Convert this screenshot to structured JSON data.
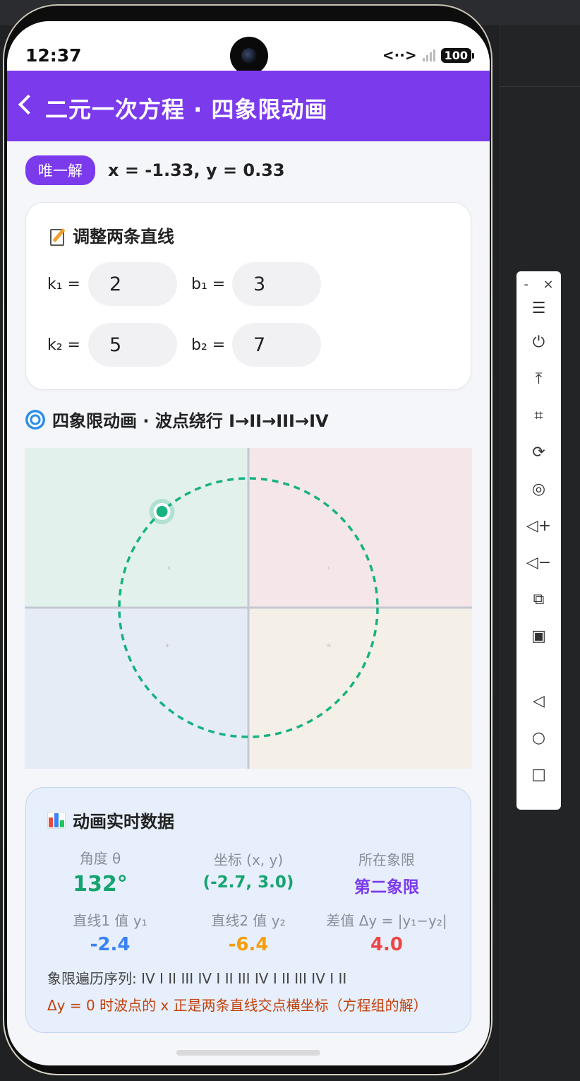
{
  "status": {
    "time": "12:37",
    "battery": "100",
    "network": "<··>"
  },
  "header": {
    "title": "二元一次方程 · 四象限动画"
  },
  "solution": {
    "badge": "唯一解",
    "text": "x = -1.33,  y = 0.33"
  },
  "inputs": {
    "title": "调整两条直线",
    "k1_label": "k₁ =",
    "k1_value": "2",
    "b1_label": "b₁ =",
    "b1_value": "3",
    "k2_label": "k₂ =",
    "k2_value": "5",
    "b2_label": "b₂ =",
    "b2_value": "7"
  },
  "animation": {
    "title": "四象限动画 · 波点绕行 I→II→III→IV",
    "quadrant_labels": [
      "II",
      "I",
      "III",
      "IV"
    ],
    "angle_deg": 132,
    "colors": {
      "q1": "#f5e6ea",
      "q2": "#e3f1ec",
      "q3": "#e6ecf6",
      "q4": "#f4f0e8",
      "orbit": "#16b281"
    }
  },
  "stats": {
    "title": "动画实时数据",
    "angle_label": "角度 θ",
    "angle_value": "132°",
    "coord_label": "坐标 (x, y)",
    "coord_value": "(-2.7, 3.0)",
    "quadrant_label": "所在象限",
    "quadrant_value": "第二象限",
    "y1_label": "直线1 值 y₁",
    "y1_value": "-2.4",
    "y2_label": "直线2 值 y₂",
    "y2_value": "-6.4",
    "diff_label": "差值 Δy = |y₁−y₂|",
    "diff_value": "4.0",
    "sequence": "象限遍历序列:  IV I II III IV I II III IV I II III IV I II",
    "note": "Δy = 0 时波点的 x 正是两条直线交点横坐标（方程组的解）"
  },
  "toolbar": {
    "minimize": "-",
    "close": "×",
    "buttons": [
      {
        "name": "menu-icon",
        "glyph": "☰"
      },
      {
        "name": "power-icon",
        "glyph": "⏻"
      },
      {
        "name": "pin-top-icon",
        "glyph": "⤒"
      },
      {
        "name": "crop-icon",
        "glyph": "⌗"
      },
      {
        "name": "rotate-icon",
        "glyph": "⟳"
      },
      {
        "name": "record-icon",
        "glyph": "◎"
      },
      {
        "name": "volume-up-icon",
        "glyph": "◁+"
      },
      {
        "name": "volume-down-icon",
        "glyph": "◁−"
      },
      {
        "name": "rotate-device-icon",
        "glyph": "⧉"
      },
      {
        "name": "mirror-icon",
        "glyph": "▣"
      },
      {
        "name": "back-nav-icon",
        "glyph": "◁"
      },
      {
        "name": "home-nav-icon",
        "glyph": "○"
      },
      {
        "name": "recents-nav-icon",
        "glyph": "□"
      }
    ]
  }
}
